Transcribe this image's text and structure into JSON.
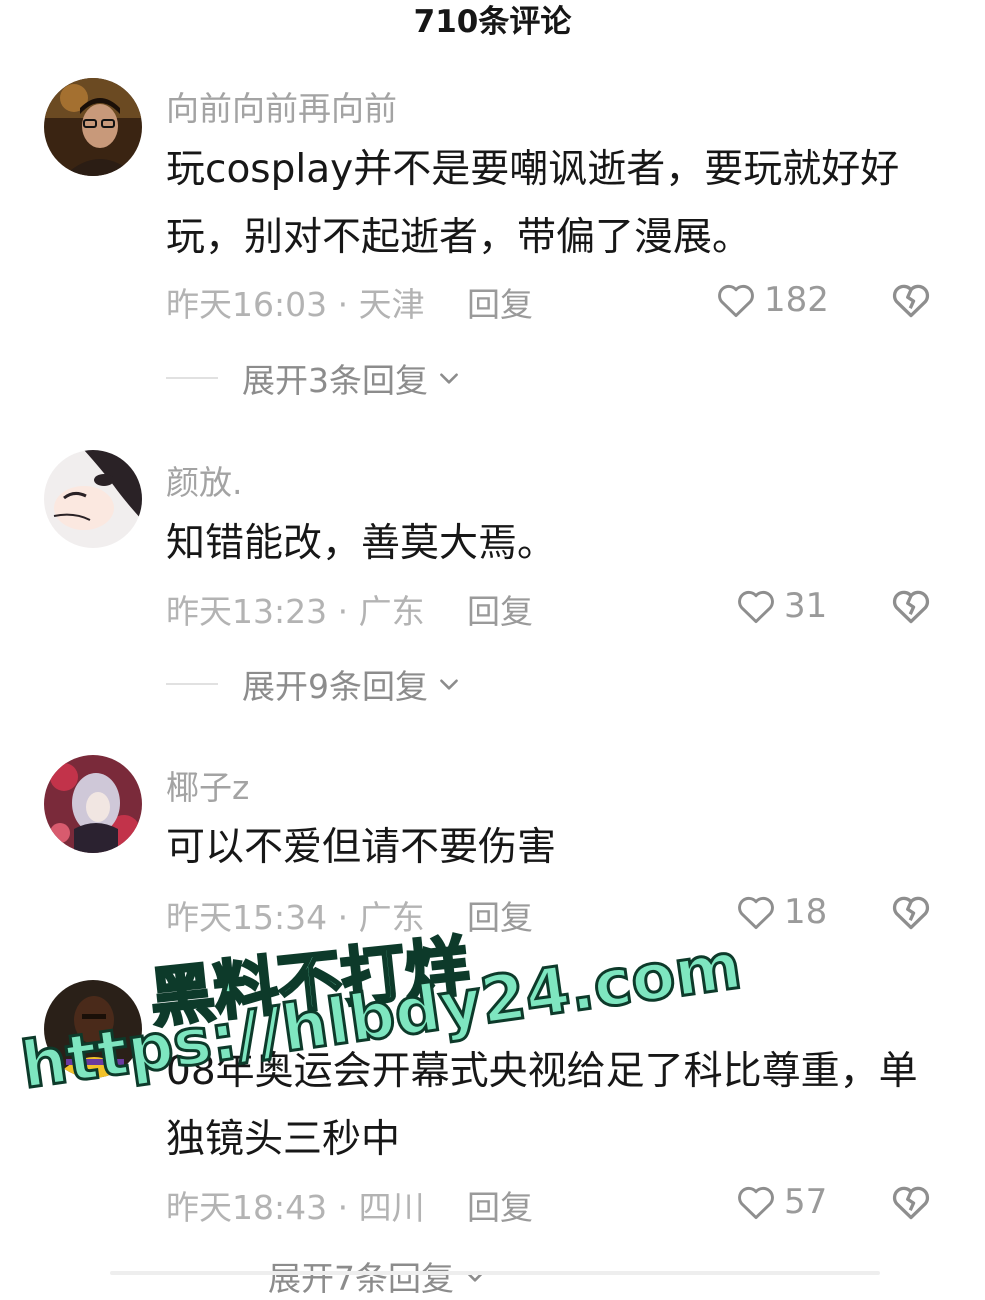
{
  "header": {
    "title": "710条评论"
  },
  "comments": [
    {
      "username": "向前向前再向前",
      "text": "玩cosplay并不是要嘲讽逝者，要玩就好好玩，别对不起逝者，带偏了漫展。",
      "meta": "昨天16:03 · 天津",
      "reply_label": "回复",
      "likes": "182",
      "expand_label": "展开3条回复"
    },
    {
      "username": "颜放.",
      "text": "知错能改，善莫大焉。",
      "meta": "昨天13:23 · 广东",
      "reply_label": "回复",
      "likes": "31",
      "expand_label": "展开9条回复"
    },
    {
      "username": "椰子z",
      "text": "可以不爱但请不要伤害",
      "meta": "昨天15:34 · 广东",
      "reply_label": "回复",
      "likes": "18"
    },
    {
      "username": "",
      "text": "08年奥运会开幕式央视给足了科比尊重，单独镜头三秒中",
      "meta": "昨天18:43 · 四川",
      "reply_label": "回复",
      "likes": "57",
      "expand_label": "展开7条回复"
    }
  ],
  "watermark": {
    "line1": "黑料不打烊",
    "line2": "https://hlbdy24.com"
  },
  "icons": {
    "like": "heart-outline-icon",
    "dislike": "broken-heart-icon",
    "expand": "chevron-down-icon"
  }
}
